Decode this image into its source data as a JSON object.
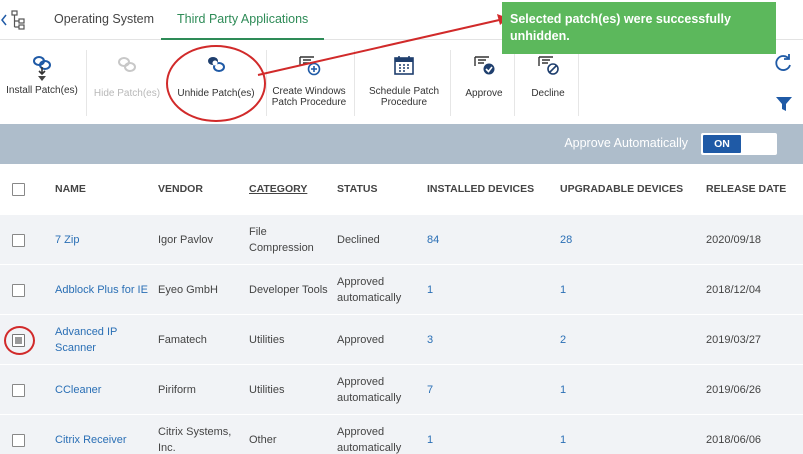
{
  "tabs": [
    {
      "label": "Operating System"
    },
    {
      "label": "Third Party Applications"
    }
  ],
  "toolbar": {
    "install": "Install Patch(es)",
    "hide": "Hide Patch(es)",
    "unhide": "Unhide Patch(es)",
    "create_line1": "Create Windows",
    "create_line2": "Patch Procedure",
    "schedule_line1": "Schedule Patch",
    "schedule_line2": "Procedure",
    "approve": "Approve",
    "decline": "Decline"
  },
  "auto": {
    "label": "Approve Automatically",
    "toggle": "ON"
  },
  "toast": {
    "message": "Selected patch(es) were successfully unhidden."
  },
  "columns": {
    "name": "NAME",
    "vendor": "VENDOR",
    "category": "CATEGORY",
    "status": "STATUS",
    "installed": "INSTALLED DEVICES",
    "upgradable": "UPGRADABLE DEVICES",
    "release": "RELEASE DATE"
  },
  "rows": [
    {
      "name": "7 Zip",
      "vendor": "Igor Pavlov",
      "category": "File Compression",
      "status": "Declined",
      "installed": "84",
      "upgradable": "28",
      "release": "2020/09/18",
      "checked": false
    },
    {
      "name": "Adblock Plus for IE",
      "vendor": "Eyeo GmbH",
      "category": "Developer Tools",
      "status": "Approved automatically",
      "installed": "1",
      "upgradable": "1",
      "release": "2018/12/04",
      "checked": false
    },
    {
      "name": "Advanced IP Scanner",
      "vendor": "Famatech",
      "category": "Utilities",
      "status": "Approved",
      "installed": "3",
      "upgradable": "2",
      "release": "2019/03/27",
      "checked": true
    },
    {
      "name": "CCleaner",
      "vendor": "Piriform",
      "category": "Utilities",
      "status": "Approved automatically",
      "installed": "7",
      "upgradable": "1",
      "release": "2019/06/26",
      "checked": false
    },
    {
      "name": "Citrix Receiver",
      "vendor": "Citrix Systems, Inc.",
      "category": "Other",
      "status": "Approved automatically",
      "installed": "1",
      "upgradable": "1",
      "release": "2018/06/06",
      "checked": false
    }
  ],
  "colors": {
    "accent_green": "#2e8b57",
    "toast_green": "#5cb85c",
    "link_blue": "#2a6fb5",
    "annotation_red": "#d12a2a",
    "bar_gray": "#aebdcb",
    "toggle_blue": "#1f5aa6"
  }
}
